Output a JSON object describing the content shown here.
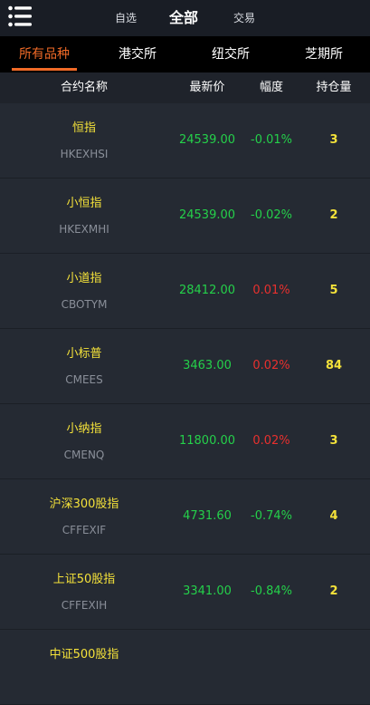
{
  "top_tabs": [
    {
      "label": "自选"
    },
    {
      "label": "全部"
    },
    {
      "label": "交易"
    }
  ],
  "sub_tabs": [
    {
      "label": "所有品种"
    },
    {
      "label": "港交所"
    },
    {
      "label": "纽交所"
    },
    {
      "label": "芝期所"
    }
  ],
  "columns": {
    "name": "合约名称",
    "price": "最新价",
    "change": "幅度",
    "oi": "持仓量"
  },
  "rows": [
    {
      "name": "恒指",
      "code": "HKEXHSI",
      "price": "24539.00",
      "change": "-0.01%",
      "oi": "3"
    },
    {
      "name": "小恒指",
      "code": "HKEXMHI",
      "price": "24539.00",
      "change": "-0.02%",
      "oi": "2"
    },
    {
      "name": "小道指",
      "code": "CBOTYM",
      "price": "28412.00",
      "change": "0.01%",
      "oi": "5"
    },
    {
      "name": "小标普",
      "code": "CMEES",
      "price": "3463.00",
      "change": "0.02%",
      "oi": "84"
    },
    {
      "name": "小纳指",
      "code": "CMENQ",
      "price": "11800.00",
      "change": "0.02%",
      "oi": "3"
    },
    {
      "name": "沪深300股指",
      "code": "CFFEXIF",
      "price": "4731.60",
      "change": "-0.74%",
      "oi": "4"
    },
    {
      "name": "上证50股指",
      "code": "CFFEXIH",
      "price": "3341.00",
      "change": "-0.84%",
      "oi": "2"
    },
    {
      "name": "中证500股指",
      "code": "",
      "price": "",
      "change": "",
      "oi": ""
    }
  ],
  "colors": {
    "accent": "#f06a27",
    "up": "#e8302e",
    "down": "#25d04a",
    "name": "#f5e23a"
  }
}
